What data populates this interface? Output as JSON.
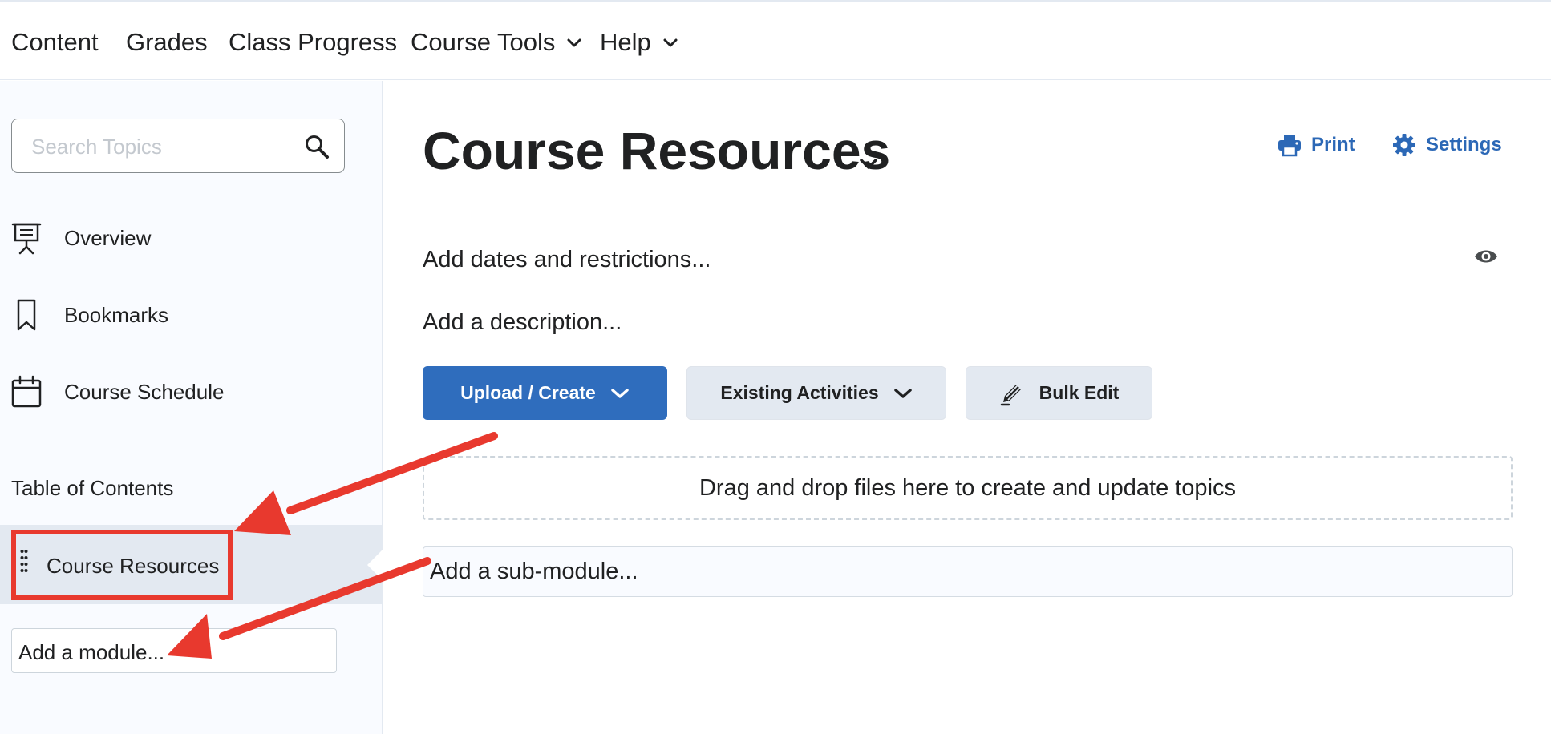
{
  "nav": {
    "items": [
      {
        "label": "Content"
      },
      {
        "label": "Grades"
      },
      {
        "label": "Class Progress"
      },
      {
        "label": "Course Tools"
      },
      {
        "label": "Help"
      }
    ]
  },
  "sidebar": {
    "search": {
      "placeholder": "Search Topics",
      "value": ""
    },
    "links": [
      {
        "label": "Overview",
        "icon": "presentation-icon"
      },
      {
        "label": "Bookmarks",
        "icon": "bookmark-icon"
      },
      {
        "label": "Course Schedule",
        "icon": "calendar-icon"
      }
    ],
    "toc_heading": "Table of Contents",
    "active_module": "Course Resources",
    "add_module": "Add a module..."
  },
  "main": {
    "title": "Course Resources",
    "print_label": "Print",
    "settings_label": "Settings",
    "add_dates": "Add dates and restrictions...",
    "add_description": "Add a description...",
    "buttons": {
      "upload_create": "Upload / Create",
      "existing_activities": "Existing Activities",
      "bulk_edit": "Bulk Edit"
    },
    "dropzone": "Drag and drop files here to create and update topics",
    "add_submodule": "Add a sub-module..."
  },
  "colors": {
    "primary": "#2f6dbd",
    "link": "#2c68b6",
    "secondary_button": "#e3e9f1",
    "annotation": "#e8392e",
    "sidebar_bg": "#f9fbff"
  }
}
